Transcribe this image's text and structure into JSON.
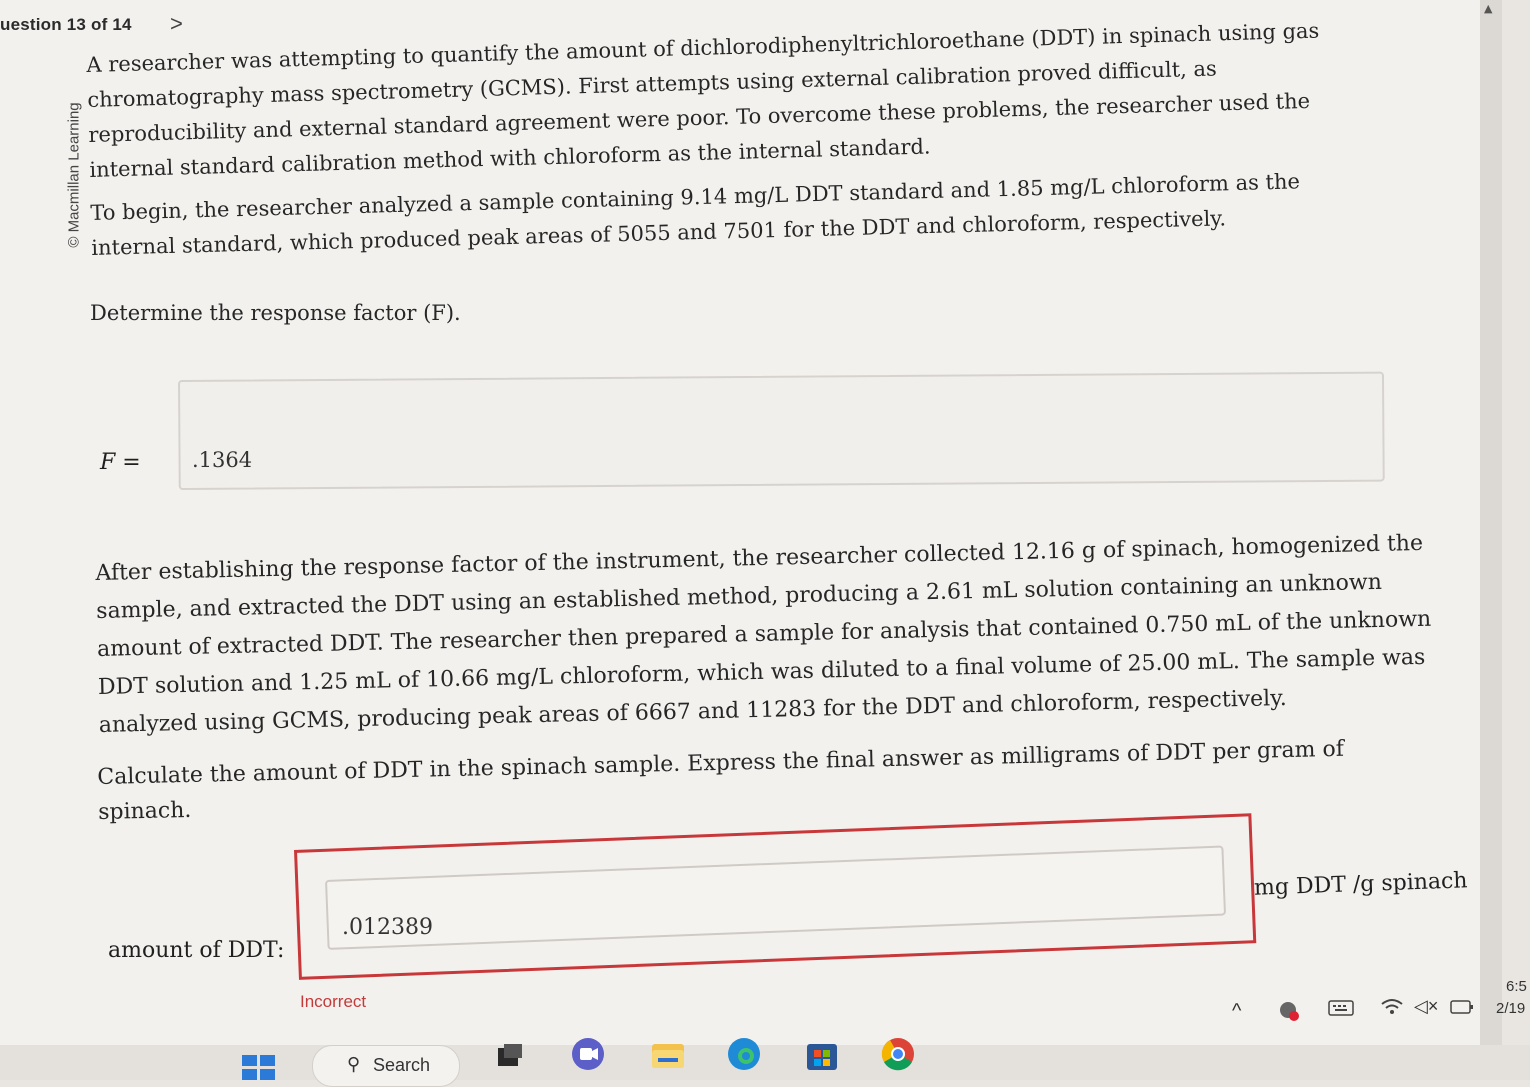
{
  "header": {
    "question_counter": "uestion 13 of 14",
    "next_glyph": ">"
  },
  "sidebar_credit": "© Macmillan Learning",
  "problem": {
    "paragraph1": "A researcher was attempting to quantify the amount of dichlorodiphenyltrichloroethane (DDT) in spinach using gas chromatography mass spectrometry (GCMS). First attempts using external calibration proved difficult, as reproducibility and external standard agreement were poor. To overcome these problems, the researcher used the internal standard calibration method with chloroform as the internal standard.",
    "paragraph2": "To begin, the researcher analyzed a sample containing 9.14 mg/L DDT standard and 1.85 mg/L chloroform as the internal standard, which produced peak areas of 5055 and 7501 for the DDT and chloroform, respectively.",
    "question1": "Determine the response factor (F).",
    "f_label": "F =",
    "f_value": ".1364",
    "paragraph3": "After establishing the response factor of the instrument, the researcher collected 12.16 g of spinach, homogenized the sample, and extracted the DDT using an established method, producing a 2.61 mL solution containing an unknown amount of extracted DDT. The researcher then prepared a sample for analysis that contained 0.750 mL of the unknown DDT solution and 1.25 mL of 10.66 mg/L chloroform, which was diluted to a final volume of 25.00 mL. The sample was analyzed using GCMS, producing peak areas of 6667 and 11283 for the DDT and chloroform, respectively.",
    "question2": "Calculate the amount of DDT in the spinach sample. Express the final answer as milligrams of DDT per gram of spinach.",
    "answer_label": "amount of DDT:",
    "answer_value": ".012389",
    "answer_unit": "mg DDT /g spinach",
    "feedback": "Incorrect"
  },
  "taskbar": {
    "search_label": "Search",
    "time": "6:5",
    "date": "2/19"
  },
  "colors": {
    "error_red": "#c8383a",
    "windows_blue": "#2b7ad8"
  }
}
